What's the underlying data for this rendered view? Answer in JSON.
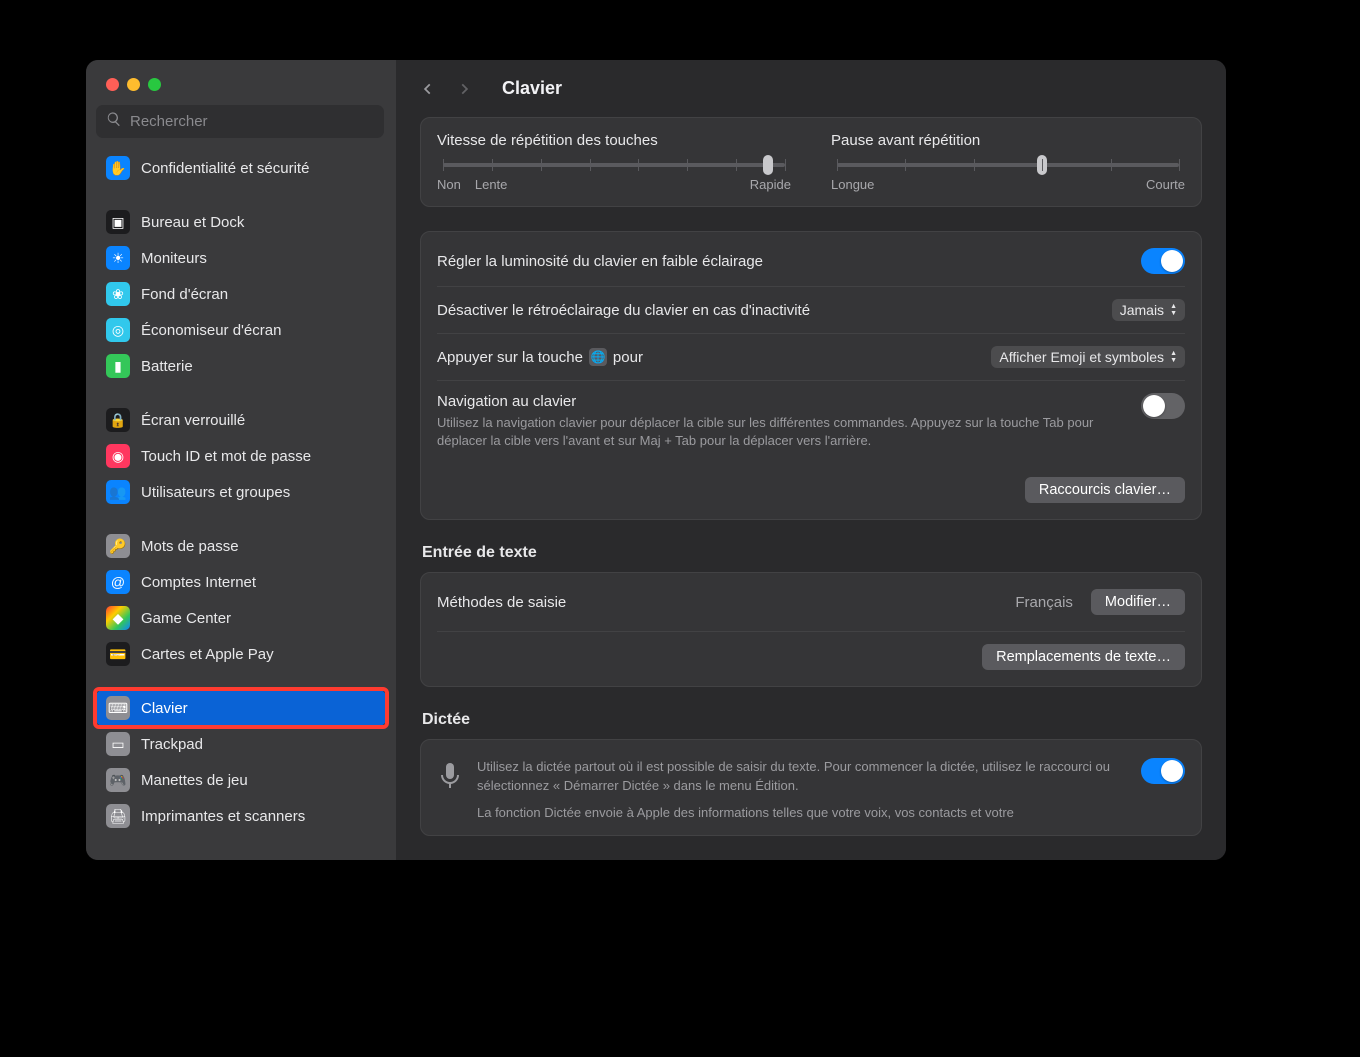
{
  "search": {
    "placeholder": "Rechercher"
  },
  "sidebar_items": [
    {
      "id": "privacy",
      "label": "Confidentialité et sécurité",
      "color": "#0a84ff",
      "glyph": "✋"
    },
    {
      "spacer": true
    },
    {
      "id": "desktop",
      "label": "Bureau et Dock",
      "color": "#1c1c1e",
      "glyph": "▣"
    },
    {
      "id": "displays",
      "label": "Moniteurs",
      "color": "#0a84ff",
      "glyph": "☀"
    },
    {
      "id": "wallpaper",
      "label": "Fond d'écran",
      "color": "#31c8ec",
      "glyph": "❀"
    },
    {
      "id": "screensaver",
      "label": "Économiseur d'écran",
      "color": "#31c8ec",
      "glyph": "◎"
    },
    {
      "id": "battery",
      "label": "Batterie",
      "color": "#34c759",
      "glyph": "▮"
    },
    {
      "spacer": true
    },
    {
      "id": "lockscreen",
      "label": "Écran verrouillé",
      "color": "#1c1c1e",
      "glyph": "🔒"
    },
    {
      "id": "touchid",
      "label": "Touch ID et mot de passe",
      "color": "#ff375f",
      "glyph": "◉"
    },
    {
      "id": "users",
      "label": "Utilisateurs et groupes",
      "color": "#0a84ff",
      "glyph": "👥"
    },
    {
      "spacer": true
    },
    {
      "id": "passwords",
      "label": "Mots de passe",
      "color": "#8e8e93",
      "glyph": "🔑"
    },
    {
      "id": "internet",
      "label": "Comptes Internet",
      "color": "#0a84ff",
      "glyph": "@"
    },
    {
      "id": "gamecenter",
      "label": "Game Center",
      "color": "linear-gradient(135deg,#ff3b30,#ffcc00,#34c759,#0a84ff)",
      "glyph": "◆"
    },
    {
      "id": "wallet",
      "label": "Cartes et Apple Pay",
      "color": "#1c1c1e",
      "glyph": "💳"
    },
    {
      "spacer": true
    },
    {
      "id": "keyboard",
      "label": "Clavier",
      "color": "#8e8e93",
      "glyph": "⌨",
      "selected": true,
      "highlight": true
    },
    {
      "id": "trackpad",
      "label": "Trackpad",
      "color": "#8e8e93",
      "glyph": "▭"
    },
    {
      "id": "gamectrl",
      "label": "Manettes de jeu",
      "color": "#8e8e93",
      "glyph": "🎮"
    },
    {
      "id": "printers",
      "label": "Imprimantes et scanners",
      "color": "#8e8e93",
      "glyph": "🖨"
    }
  ],
  "header": {
    "title": "Clavier"
  },
  "sliders": {
    "repeat": {
      "title": "Vitesse de répétition des touches",
      "left": "Non",
      "left2": "Lente",
      "right": "Rapide",
      "pos": 0.95
    },
    "delay": {
      "title": "Pause avant répétition",
      "left": "Longue",
      "right": "Courte",
      "pos": 0.6
    }
  },
  "rows": {
    "brightness": {
      "label": "Régler la luminosité du clavier en faible éclairage",
      "on": true
    },
    "backlight": {
      "label": "Désactiver le rétroéclairage du clavier en cas d'inactivité",
      "value": "Jamais"
    },
    "globe": {
      "label_pre": "Appuyer sur la touche",
      "label_post": "pour",
      "value": "Afficher Emoji et symboles"
    },
    "nav": {
      "label": "Navigation au clavier",
      "on": false,
      "desc": "Utilisez la navigation clavier pour déplacer la cible sur les différentes commandes. Appuyez sur la touche Tab pour déplacer la cible vers l'avant et sur Maj + Tab pour la déplacer vers l'arrière."
    },
    "shortcut_btn": "Raccourcis clavier…"
  },
  "text_section": {
    "heading": "Entrée de texte",
    "input_methods_label": "Méthodes de saisie",
    "input_methods_value": "Français",
    "modify_btn": "Modifier…",
    "replacements_btn": "Remplacements de texte…"
  },
  "dictation": {
    "heading": "Dictée",
    "on": true,
    "desc1": "Utilisez la dictée partout où il est possible de saisir du texte. Pour commencer la dictée, utilisez le raccourci ou sélectionnez « Démarrer Dictée » dans le menu Édition.",
    "desc2": "La fonction Dictée envoie à Apple des informations telles que votre voix, vos contacts et votre"
  }
}
